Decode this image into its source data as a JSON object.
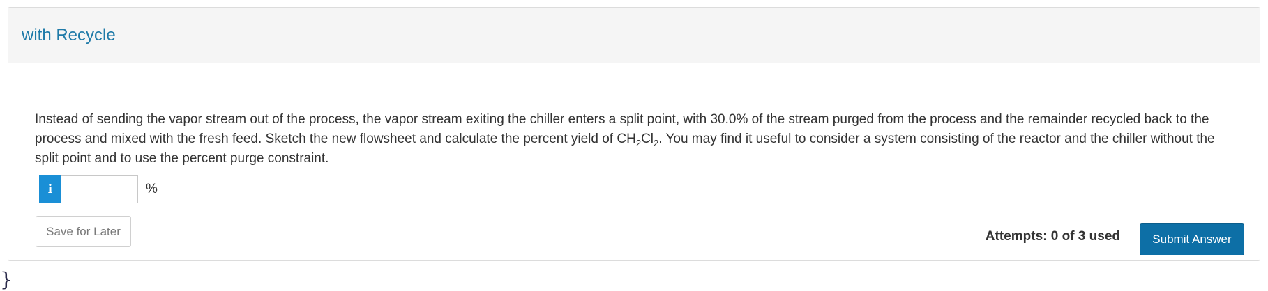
{
  "header": {
    "title": "with Recycle"
  },
  "question": {
    "text_before_formula": "Instead of sending the vapor stream out of the process, the vapor stream exiting the chiller enters a split point, with 30.0% of the stream purged from the process and the remainder recycled back to the process and mixed with the fresh feed.  Sketch the new flowsheet and calculate the percent yield of ",
    "formula_ch": "CH",
    "formula_sub_1": "2",
    "formula_cl": "Cl",
    "formula_sub_2": "2",
    "text_after_formula": ".  You may find it useful to consider a system consisting of the reactor and the chiller without the split point and to use the percent purge constraint."
  },
  "answer": {
    "info_icon": "info-icon",
    "info_glyph": "i",
    "value": "",
    "placeholder": "",
    "unit": "%"
  },
  "footer": {
    "save_label": "Save for Later",
    "attempts_text": "Attempts: 0 of 3 used",
    "submit_label": "Submit Answer"
  },
  "colors": {
    "title": "#1f7aa8",
    "info_button": "#1a8fd6",
    "submit_button": "#0d6fa6",
    "header_bg": "#f5f5f5"
  }
}
